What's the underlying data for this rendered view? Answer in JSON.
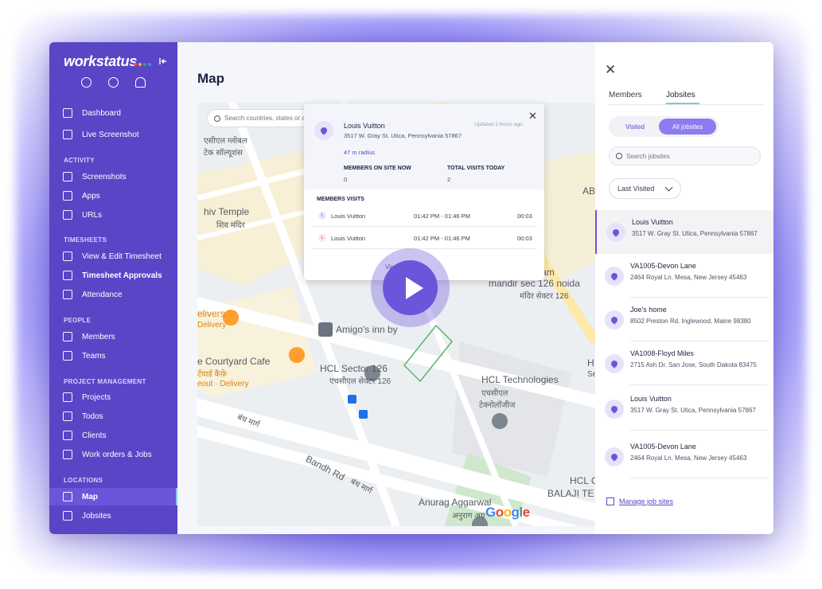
{
  "app": {
    "brand": "workstatus",
    "brand_dot_colors": [
      "#f14c4c",
      "#f4b400",
      "#34a853",
      "#4285f4"
    ],
    "page_title": "Map"
  },
  "sidebar": {
    "top": [
      {
        "label": "Dashboard",
        "icon": "dashboard-icon"
      },
      {
        "label": "Live Screenshot",
        "icon": "screenshot-icon"
      }
    ],
    "sections": [
      {
        "title": "ACTIVITY",
        "items": [
          {
            "label": "Screenshots",
            "icon": "camera-icon"
          },
          {
            "label": "Apps",
            "icon": "apps-icon"
          },
          {
            "label": "URLs",
            "icon": "link-icon"
          }
        ]
      },
      {
        "title": "TIMESHEETS",
        "items": [
          {
            "label": "View & Edit Timesheet",
            "icon": "clock-icon"
          },
          {
            "label": "Timesheet Approvals",
            "icon": "calendar-check-icon"
          },
          {
            "label": "Attendance",
            "icon": "attendance-icon"
          }
        ]
      },
      {
        "title": "PEOPLE",
        "items": [
          {
            "label": "Members",
            "icon": "user-icon"
          },
          {
            "label": "Teams",
            "icon": "team-icon"
          }
        ]
      },
      {
        "title": "PROJECT MANAGEMENT",
        "items": [
          {
            "label": "Projects",
            "icon": "folder-icon"
          },
          {
            "label": "Todos",
            "icon": "todo-icon"
          },
          {
            "label": "Clients",
            "icon": "clients-icon"
          },
          {
            "label": "Work orders & Jobs",
            "icon": "work-order-icon"
          }
        ]
      },
      {
        "title": "LOCATIONS",
        "items": [
          {
            "label": "Map",
            "icon": "map-icon"
          },
          {
            "label": "Jobsites",
            "icon": "building-icon"
          }
        ]
      }
    ]
  },
  "map": {
    "search_placeholder": "Search countries, states or c",
    "labels": [
      "एसीएल ग्लोबल",
      "टेक सॉल्यूशंस",
      "hiv Temple",
      "शिव मंदिर",
      "ABI",
      "mohan ram",
      "mandir sec 126 noida",
      "मंदिर सेक्टर 126",
      "elivers",
      "Delivery",
      "Amigo's inn by",
      "e Courtyard Cafe",
      "र्टयार्ड कैफ़े",
      "eout · Delivery",
      "HCL Sector 126",
      "एचसीएल सेक्टर 126",
      "HCL Technologies",
      "एचसीएल",
      "टेक्नोलॉजीज",
      "बंध मार्ग",
      "Bandh Rd",
      "बंध मार्ग",
      "Anurag Aggarwal",
      "अनुराग अग्र",
      "HCL C",
      "BALAJI TE",
      "H",
      "Se"
    ],
    "google": "Google"
  },
  "popup": {
    "name": "Louis Vuitton",
    "address": "3517 W. Gray St. Utica, Pennsylvania 57867",
    "radius": "47 m radius",
    "updated": "Updated 2 hours ago",
    "members_on_site_label": "MEMBERS ON SITE NOW",
    "members_on_site_value": "0",
    "total_visits_label": "TOTAL VISITS TODAY",
    "total_visits_value": "2",
    "visits_title": "MEMBERS VISITS",
    "visits": [
      {
        "initial": "L",
        "name": "Louis Vuitton",
        "time": "01:42 PM - 01:46 PM",
        "duration": "00:03"
      },
      {
        "initial": "L",
        "name": "Louis Vuitton",
        "time": "01:42 PM - 01:46 PM",
        "duration": "00:03"
      }
    ],
    "report_link": "View  report ›"
  },
  "panel": {
    "tabs": [
      "Members",
      "Jobsites"
    ],
    "active_tab": "Jobsites",
    "toggle": [
      "Visited",
      "All jobsites"
    ],
    "search_placeholder": "Search jobsites",
    "sort": "Last Visited",
    "jobsites": [
      {
        "name": "Louis Vuitton",
        "address": "3517 W. Gray St. Utica, Pennsylvania 57867"
      },
      {
        "name": "VA1005-Devon Lane",
        "address": "2464 Royal Ln. Mesa, New Jersey 45463"
      },
      {
        "name": "Joe's home",
        "address": "8502 Preston Rd. Inglewood, Maine 98380"
      },
      {
        "name": "VA1008-Floyd Miles",
        "address": "2715 Ash Dr. San Jose, South Dakota 83475"
      },
      {
        "name": "Louis Vuitton",
        "address": "3517 W. Gray St. Utica, Pennsylvania 57867"
      },
      {
        "name": "VA1005-Devon Lane",
        "address": "2464 Royal Ln. Mesa, New Jersey 45463"
      }
    ],
    "manage_link": "Manage job sites"
  },
  "colors": {
    "sidebar": "#5a45c6",
    "accent": "#6a56db",
    "map_highway": "#ffe9a6",
    "map_orange": "#d9840f"
  }
}
